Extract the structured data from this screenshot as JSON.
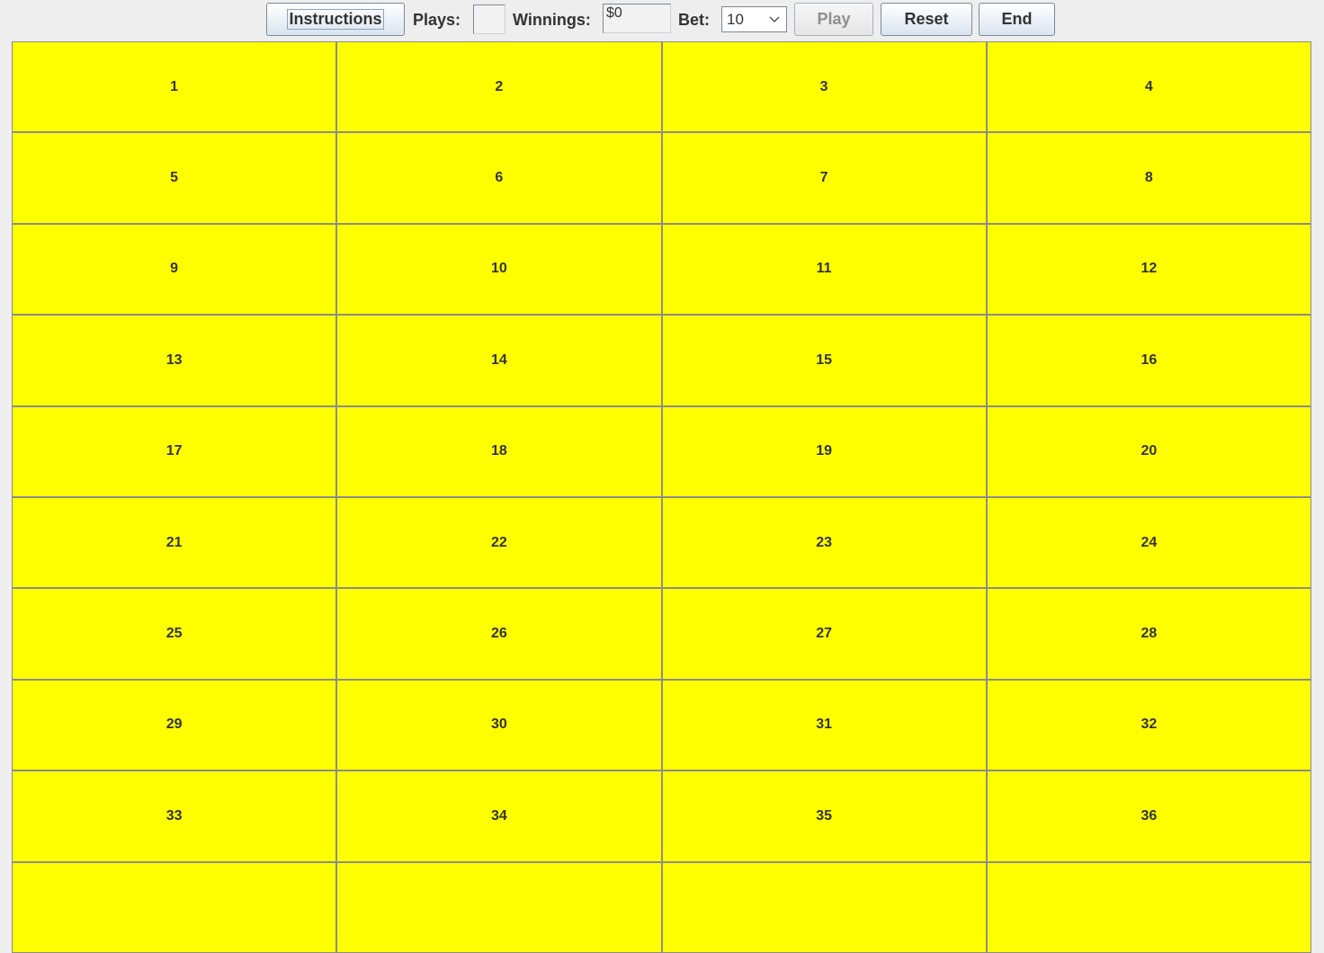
{
  "toolbar": {
    "instructions_label": "Instructions",
    "plays_label": "Plays:",
    "plays_value": "",
    "winnings_label": "Winnings:",
    "winnings_value": "$0",
    "bet_label": "Bet:",
    "bet_value": "10",
    "play_label": "Play",
    "reset_label": "Reset",
    "end_label": "End"
  },
  "grid": {
    "cells": [
      "1",
      "2",
      "3",
      "4",
      "5",
      "6",
      "7",
      "8",
      "9",
      "10",
      "11",
      "12",
      "13",
      "14",
      "15",
      "16",
      "17",
      "18",
      "19",
      "20",
      "21",
      "22",
      "23",
      "24",
      "25",
      "26",
      "27",
      "28",
      "29",
      "30",
      "31",
      "32",
      "33",
      "34",
      "35",
      "36",
      "",
      "",
      "",
      ""
    ]
  },
  "colors": {
    "cell_fill": "#ffff00",
    "cell_border": "#8c8c8c",
    "background": "#eeeeee"
  },
  "icons": {
    "bet_dropdown": "chevron-down-icon"
  }
}
